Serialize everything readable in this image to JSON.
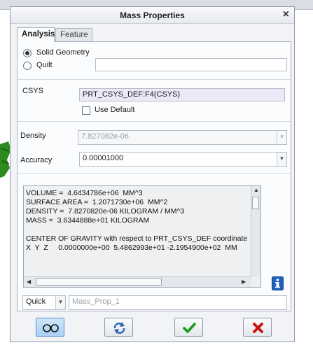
{
  "dialog": {
    "title": "Mass Properties"
  },
  "tabs": [
    {
      "label": "Analysis"
    },
    {
      "label": "Feature"
    }
  ],
  "geometry": {
    "solid_label": "Solid Geometry",
    "quilt_label": "Quilt",
    "quilt_value": ""
  },
  "csys": {
    "label": "CSYS",
    "value": "PRT_CSYS_DEF:F4(CSYS)",
    "use_default_label": "Use Default"
  },
  "density": {
    "label": "Density",
    "value": "7.827082e-06"
  },
  "accuracy": {
    "label": "Accuracy",
    "value": "0.00001000"
  },
  "results": {
    "lines": [
      "VOLUME =  4.6434786e+06  MM^3",
      "SURFACE AREA =  1.2071730e+06  MM^2",
      "DENSITY =  7.8270820e-06 KILOGRAM / MM^3",
      "MASS =  3.6344888e+01 KILOGRAM",
      "",
      "CENTER OF GRAVITY with respect to PRT_CSYS_DEF coordinate",
      "X  Y  Z     0.0000000e+00  5.4862993e+01 -2.1954900e+02  MM"
    ]
  },
  "save": {
    "mode": "Quick",
    "name_placeholder": "Mass_Prop_1"
  },
  "colors": {
    "ok": "#1a9a1a",
    "cancel": "#cc1111",
    "info": "#1f5fbf",
    "recompute": "#2a64b8"
  },
  "icons": {
    "preview": "glasses-icon",
    "recompute": "recompute-arrows-icon",
    "ok": "checkmark-icon",
    "cancel": "x-icon",
    "info": "info-icon"
  }
}
